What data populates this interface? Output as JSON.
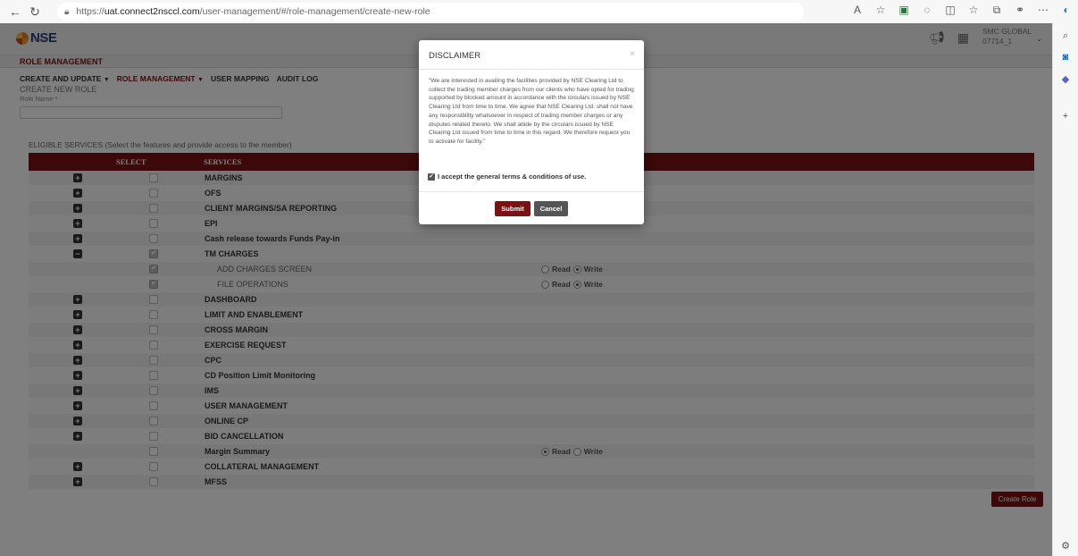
{
  "browser": {
    "url_prefix": "https://",
    "url_host": "uat.connect2nsccl.com",
    "url_path": "/user-management/#/role-management/create-new-role",
    "icons": [
      "back-icon",
      "refresh-icon",
      "lock-icon",
      "read-aloud-icon",
      "favorite-icon",
      "excel-extension-icon",
      "extension-icon",
      "split-screen-icon",
      "favorites-bar-icon",
      "collections-icon",
      "copilot-icon",
      "more-icon",
      "edge-icon"
    ]
  },
  "header": {
    "logo_text": "NSE",
    "logo_sub": "Clearing",
    "user_name": "SMC GLOBAL",
    "user_id": "07714_1"
  },
  "section_title": "ROLE MANAGEMENT",
  "menu": {
    "create_update": "CREATE AND UPDATE",
    "role_management": "ROLE MANAGEMENT",
    "user_mapping": "USER MAPPING",
    "audit_log": "AUDIT LOG"
  },
  "page_title": "CREATE NEW ROLE",
  "role_name_label": "Role Name *",
  "role_name_value": "",
  "eligible_label": "ELIGIBLE SERVICES (Select the features and provide access to the member)",
  "table": {
    "headers": {
      "select": "SELECT",
      "services": "SERVICES"
    },
    "read_label": "Read",
    "write_label": "Write",
    "rows": [
      {
        "name": "MARGINS",
        "expander": "+",
        "checked": false,
        "sub": false,
        "perm": null
      },
      {
        "name": "OFS",
        "expander": "+",
        "checked": false,
        "sub": false,
        "perm": null
      },
      {
        "name": "CLIENT MARGINS/SA REPORTING",
        "expander": "+",
        "checked": false,
        "sub": false,
        "perm": null
      },
      {
        "name": "EPI",
        "expander": "+",
        "checked": false,
        "sub": false,
        "perm": null
      },
      {
        "name": "Cash release towards Funds Pay-in",
        "expander": "+",
        "checked": false,
        "sub": false,
        "perm": null
      },
      {
        "name": "TM CHARGES",
        "expander": "−",
        "checked": true,
        "sub": false,
        "perm": null
      },
      {
        "name": "ADD CHARGES SCREEN",
        "expander": "",
        "checked": true,
        "sub": true,
        "perm": "write"
      },
      {
        "name": "FILE OPERATIONS",
        "expander": "",
        "checked": true,
        "sub": true,
        "perm": "write"
      },
      {
        "name": "DASHBOARD",
        "expander": "+",
        "checked": false,
        "sub": false,
        "perm": null
      },
      {
        "name": "LIMIT AND ENABLEMENT",
        "expander": "+",
        "checked": false,
        "sub": false,
        "perm": null
      },
      {
        "name": "CROSS MARGIN",
        "expander": "+",
        "checked": false,
        "sub": false,
        "perm": null
      },
      {
        "name": "EXERCISE REQUEST",
        "expander": "+",
        "checked": false,
        "sub": false,
        "perm": null
      },
      {
        "name": "CPC",
        "expander": "+",
        "checked": false,
        "sub": false,
        "perm": null
      },
      {
        "name": "CD Position Limit Monitoring",
        "expander": "+",
        "checked": false,
        "sub": false,
        "perm": null
      },
      {
        "name": "IMS",
        "expander": "+",
        "checked": false,
        "sub": false,
        "perm": null
      },
      {
        "name": "USER MANAGEMENT",
        "expander": "+",
        "checked": false,
        "sub": false,
        "perm": null
      },
      {
        "name": "ONLINE CP",
        "expander": "+",
        "checked": false,
        "sub": false,
        "perm": null
      },
      {
        "name": "BID CANCELLATION",
        "expander": "+",
        "checked": false,
        "sub": false,
        "perm": null
      },
      {
        "name": "Margin Summary",
        "expander": "",
        "checked": false,
        "sub": false,
        "perm": "read"
      },
      {
        "name": "COLLATERAL MANAGEMENT",
        "expander": "+",
        "checked": false,
        "sub": false,
        "perm": null
      },
      {
        "name": "MFSS",
        "expander": "+",
        "checked": false,
        "sub": false,
        "perm": null
      }
    ]
  },
  "create_role_button": "Create Role",
  "modal": {
    "title": "DISCLAIMER",
    "close": "×",
    "body": "\"We are interested in availing the facilities provided by NSE Clearing Ltd to collect the trading member charges from our clients who have opted for trading supported by blocked amount in accordance with the circulars issued by NSE Clearing Ltd from time to time. We agree that NSE Clearing Ltd. shall not have any responsibility whatsoever in respect of trading member charges or any disputes related thereto. We shall abide by the circulars issued by NSE Clearing Ltd issued from time to time in this regard. We therefore request you to activate for facility.\"",
    "accept_label": "I accept the general terms & conditions of use.",
    "accept_checked": true,
    "submit": "Submit",
    "cancel": "Cancel"
  }
}
